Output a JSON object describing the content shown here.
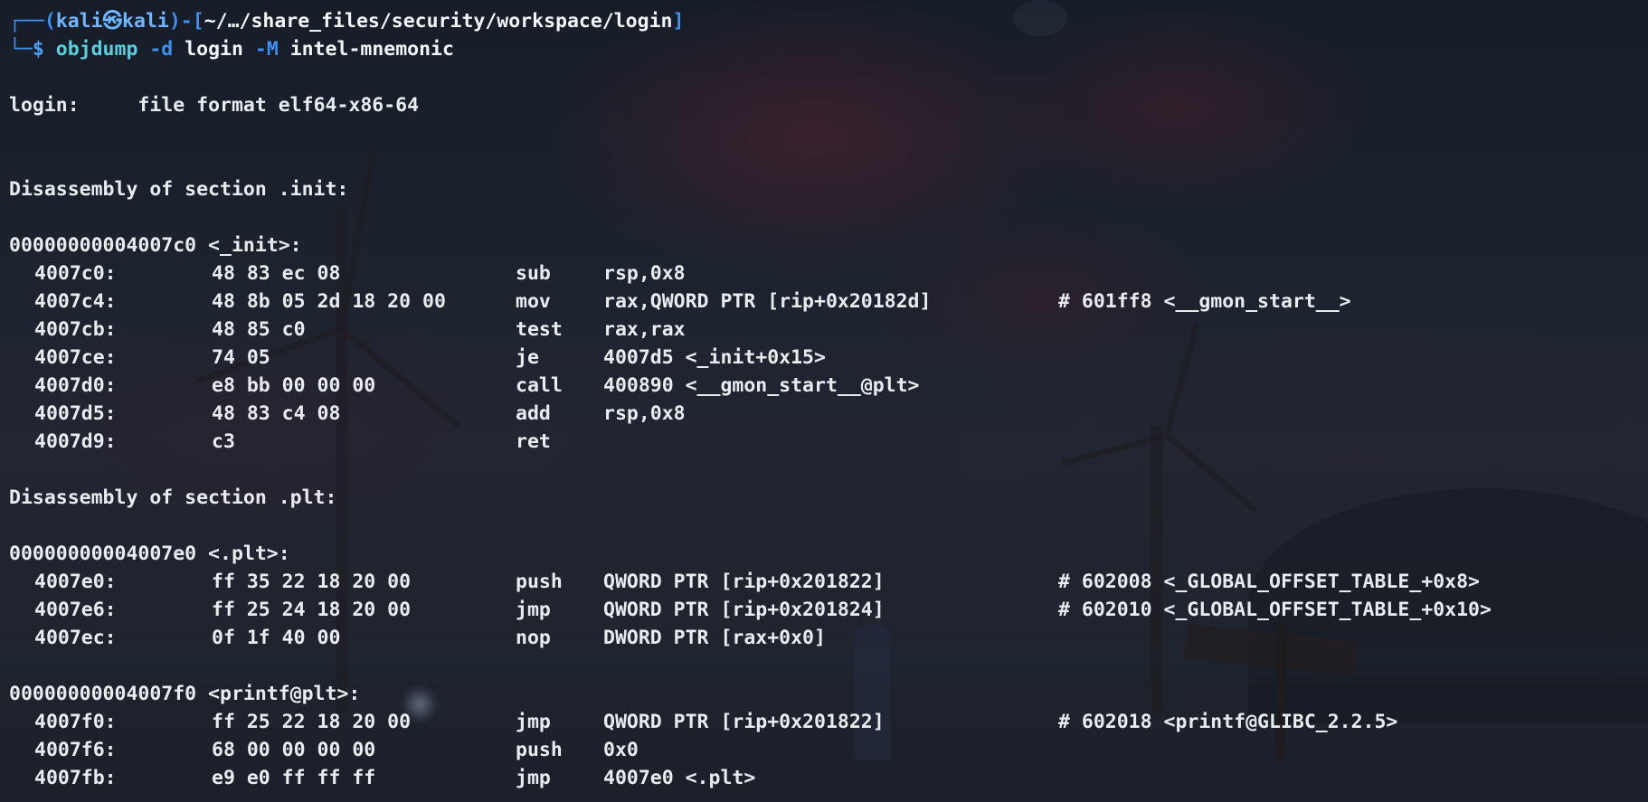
{
  "prompt": {
    "frame_top": "┌──(",
    "user_host": "kali㉿kali",
    "frame_mid": ")-[",
    "path": "~/…/share_files/security/workspace/login",
    "frame_end": "]",
    "frame_bottom": "└─",
    "dollar": "$ ",
    "command": "objdump",
    "flag_d": "-d",
    "target": "login",
    "flag_m": "-M",
    "option": "intel-mnemonic"
  },
  "header": {
    "file_name": "login:",
    "file_format": "file format elf64-x86-64"
  },
  "sections": [
    {
      "title": "Disassembly of section .init:",
      "functions": [
        {
          "label": "00000000004007c0 <_init>:",
          "instructions": [
            {
              "addr": "4007c0:",
              "bytes": "48 83 ec 08",
              "mnemonic": "sub",
              "operands": "rsp,0x8",
              "comment": ""
            },
            {
              "addr": "4007c4:",
              "bytes": "48 8b 05 2d 18 20 00",
              "mnemonic": "mov",
              "operands": "rax,QWORD PTR [rip+0x20182d]",
              "comment": "# 601ff8 <__gmon_start__>"
            },
            {
              "addr": "4007cb:",
              "bytes": "48 85 c0",
              "mnemonic": "test",
              "operands": "rax,rax",
              "comment": ""
            },
            {
              "addr": "4007ce:",
              "bytes": "74 05",
              "mnemonic": "je",
              "operands": "4007d5 <_init+0x15>",
              "comment": ""
            },
            {
              "addr": "4007d0:",
              "bytes": "e8 bb 00 00 00",
              "mnemonic": "call",
              "operands": "400890 <__gmon_start__@plt>",
              "comment": ""
            },
            {
              "addr": "4007d5:",
              "bytes": "48 83 c4 08",
              "mnemonic": "add",
              "operands": "rsp,0x8",
              "comment": ""
            },
            {
              "addr": "4007d9:",
              "bytes": "c3",
              "mnemonic": "ret",
              "operands": "",
              "comment": ""
            }
          ]
        }
      ]
    },
    {
      "title": "Disassembly of section .plt:",
      "functions": [
        {
          "label": "00000000004007e0 <.plt>:",
          "instructions": [
            {
              "addr": "4007e0:",
              "bytes": "ff 35 22 18 20 00",
              "mnemonic": "push",
              "operands": "QWORD PTR [rip+0x201822]",
              "comment": "# 602008 <_GLOBAL_OFFSET_TABLE_+0x8>"
            },
            {
              "addr": "4007e6:",
              "bytes": "ff 25 24 18 20 00",
              "mnemonic": "jmp",
              "operands": "QWORD PTR [rip+0x201824]",
              "comment": "# 602010 <_GLOBAL_OFFSET_TABLE_+0x10>"
            },
            {
              "addr": "4007ec:",
              "bytes": "0f 1f 40 00",
              "mnemonic": "nop",
              "operands": "DWORD PTR [rax+0x0]",
              "comment": ""
            }
          ]
        },
        {
          "label": "00000000004007f0 <printf@plt>:",
          "instructions": [
            {
              "addr": "4007f0:",
              "bytes": "ff 25 22 18 20 00",
              "mnemonic": "jmp",
              "operands": "QWORD PTR [rip+0x201822]",
              "comment": "# 602018 <printf@GLIBC_2.2.5>"
            },
            {
              "addr": "4007f6:",
              "bytes": "68 00 00 00 00",
              "mnemonic": "push",
              "operands": "0x0",
              "comment": ""
            },
            {
              "addr": "4007fb:",
              "bytes": "e9 e0 ff ff ff",
              "mnemonic": "jmp",
              "operands": "4007e0 <.plt>",
              "comment": ""
            }
          ]
        }
      ]
    }
  ]
}
